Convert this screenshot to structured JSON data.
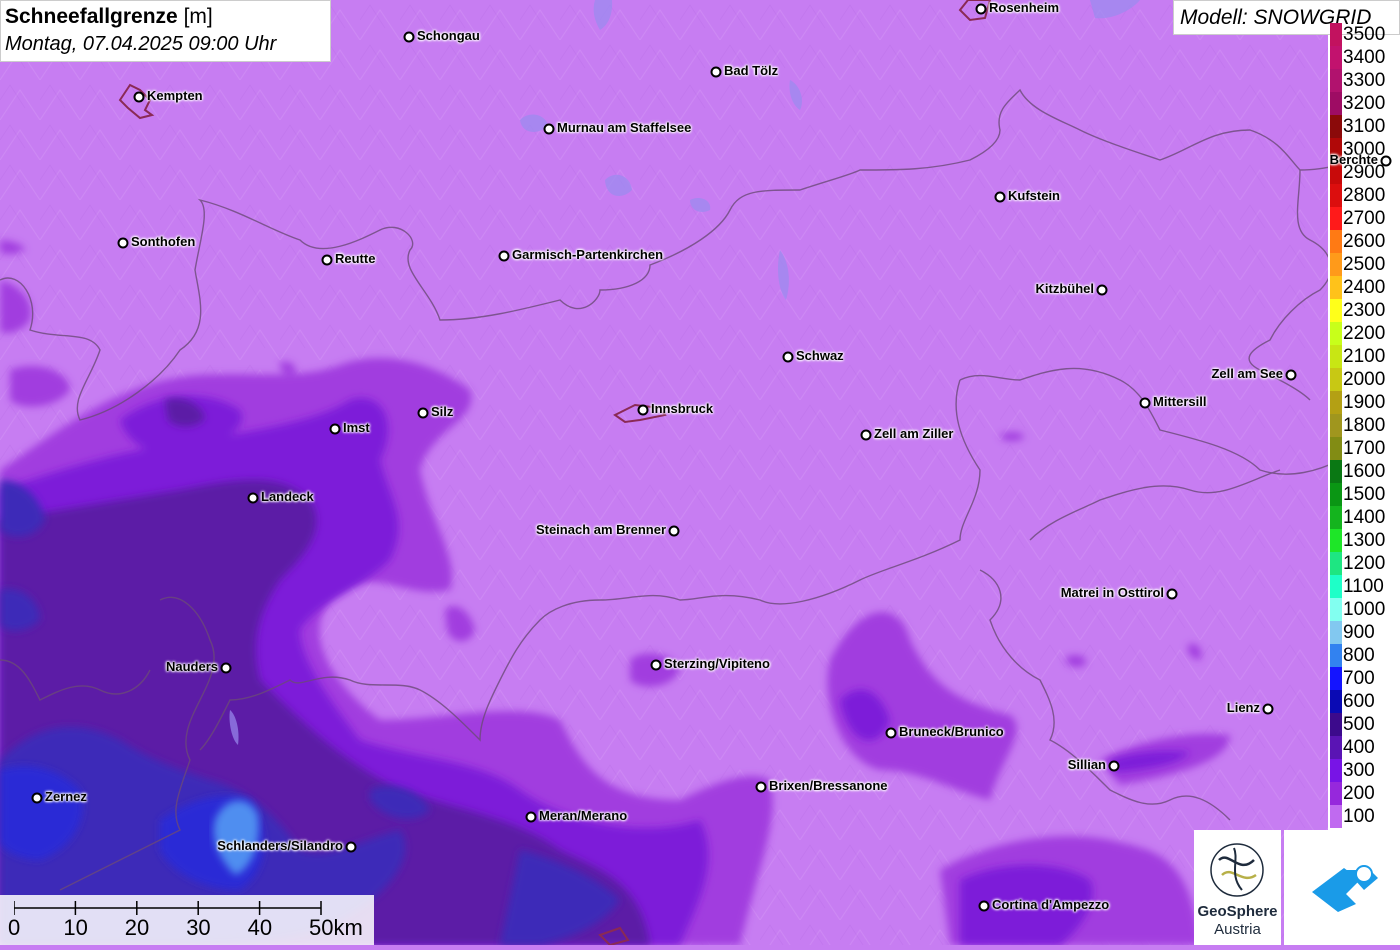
{
  "title": {
    "variable": "Schneefallgrenze",
    "unit": "[m]",
    "datetime": "Montag, 07.04.2025 09:00 Uhr"
  },
  "model_label": "Modell: SNOWGRID",
  "legend": [
    {
      "label": "3500",
      "color": "#c2125f"
    },
    {
      "label": "3400",
      "color": "#c2126e"
    },
    {
      "label": "3300",
      "color": "#b1126e"
    },
    {
      "label": "3200",
      "color": "#9e0c64"
    },
    {
      "label": "3100",
      "color": "#8b0a0a"
    },
    {
      "label": "3000",
      "color": "#b00808"
    },
    {
      "label": "2900",
      "color": "#c80a0a"
    },
    {
      "label": "2800",
      "color": "#dc0e0e"
    },
    {
      "label": "2700",
      "color": "#ff1a1a"
    },
    {
      "label": "2600",
      "color": "#ff7a14"
    },
    {
      "label": "2500",
      "color": "#ff9a1a"
    },
    {
      "label": "2400",
      "color": "#ffc21a"
    },
    {
      "label": "2300",
      "color": "#ffff1a"
    },
    {
      "label": "2200",
      "color": "#c8ff1a"
    },
    {
      "label": "2100",
      "color": "#c8e614"
    },
    {
      "label": "2000",
      "color": "#c8c814"
    },
    {
      "label": "1900",
      "color": "#b4a014"
    },
    {
      "label": "1800",
      "color": "#a0961e"
    },
    {
      "label": "1700",
      "color": "#828c14"
    },
    {
      "label": "1600",
      "color": "#0a7814"
    },
    {
      "label": "1500",
      "color": "#0a9614"
    },
    {
      "label": "1400",
      "color": "#14b41e"
    },
    {
      "label": "1300",
      "color": "#1ee628"
    },
    {
      "label": "1200",
      "color": "#1ee682"
    },
    {
      "label": "1100",
      "color": "#1effc8"
    },
    {
      "label": "1000",
      "color": "#82fff0"
    },
    {
      "label": "900",
      "color": "#82c8f0"
    },
    {
      "label": "800",
      "color": "#3282f0"
    },
    {
      "label": "700",
      "color": "#1414ff"
    },
    {
      "label": "600",
      "color": "#0a0ab4"
    },
    {
      "label": "500",
      "color": "#3c0a8c"
    },
    {
      "label": "400",
      "color": "#5a14b4"
    },
    {
      "label": "300",
      "color": "#7814e6"
    },
    {
      "label": "200",
      "color": "#9628dc"
    },
    {
      "label": "100",
      "color": "#c06af0"
    }
  ],
  "cities": [
    {
      "name": "Rosenheim",
      "side": "right"
    },
    {
      "name": "Schongau",
      "side": "right"
    },
    {
      "name": "Kempten",
      "side": "right"
    },
    {
      "name": "Bad Tölz",
      "side": "right"
    },
    {
      "name": "Murnau am Staffelsee",
      "side": "right"
    },
    {
      "name": "Berchte",
      "side": "left"
    },
    {
      "name": "Kufstein",
      "side": "right"
    },
    {
      "name": "Sonthofen",
      "side": "right"
    },
    {
      "name": "Reutte",
      "side": "right"
    },
    {
      "name": "Garmisch-Partenkirchen",
      "side": "right"
    },
    {
      "name": "Kitzbühel",
      "side": "left"
    },
    {
      "name": "Schwaz",
      "side": "right"
    },
    {
      "name": "Zell am See",
      "side": "left"
    },
    {
      "name": "Mittersill",
      "side": "right"
    },
    {
      "name": "Imst",
      "side": "right"
    },
    {
      "name": "Silz",
      "side": "right"
    },
    {
      "name": "Innsbruck",
      "side": "right"
    },
    {
      "name": "Zell am Ziller",
      "side": "right"
    },
    {
      "name": "Landeck",
      "side": "right"
    },
    {
      "name": "Steinach am Brenner",
      "side": "left"
    },
    {
      "name": "Matrei in Osttirol",
      "side": "left"
    },
    {
      "name": "Nauders",
      "side": "left"
    },
    {
      "name": "Sterzing/Vipiteno",
      "side": "right"
    },
    {
      "name": "Lienz",
      "side": "left"
    },
    {
      "name": "Bruneck/Brunico",
      "side": "right"
    },
    {
      "name": "Sillian",
      "side": "left"
    },
    {
      "name": "Brixen/Bressanone",
      "side": "right"
    },
    {
      "name": "Zernez",
      "side": "right"
    },
    {
      "name": "Meran/Merano",
      "side": "right"
    },
    {
      "name": "Schlanders/Silandro",
      "side": "left"
    },
    {
      "name": "Cortina d'Ampezzo",
      "side": "right"
    }
  ],
  "scale_bar": [
    "0",
    "10",
    "20",
    "30",
    "40",
    "50km"
  ],
  "logos": {
    "geosphere_line1": "GeoSphere",
    "geosphere_line2": "Austria"
  },
  "colors": {
    "background": "#c77df2",
    "band_200": "#a13cdf",
    "band_300": "#7d1fd9",
    "band_400": "#5c1ca6",
    "band_600": "#3d2ab8",
    "band_700": "#2a2ad6",
    "band_800": "#4f8ef0",
    "border": "#6b4a78",
    "city_outline": "#8a2a55"
  }
}
